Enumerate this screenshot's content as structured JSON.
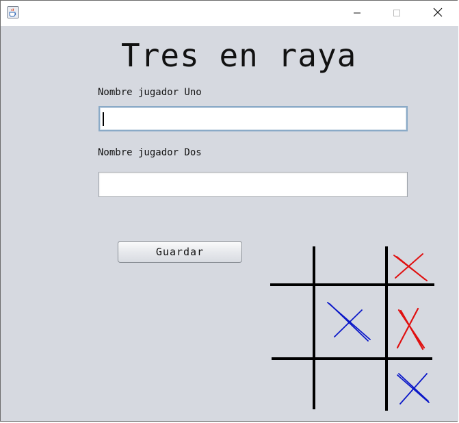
{
  "window": {
    "title": "",
    "icon": "java-cup-icon"
  },
  "titlebar_buttons": {
    "minimize_icon": "minimize-icon",
    "maximize_icon": "maximize-icon",
    "close_icon": "close-icon"
  },
  "app": {
    "title": "Tres en raya",
    "player_one_label": "Nombre jugador Uno",
    "player_one_value": "",
    "player_two_label": "Nombre jugador Dos",
    "player_two_value": "",
    "save_label": "Guardar"
  },
  "board_art": {
    "description_icon": "tic-tac-toe-board-image",
    "marks": [
      {
        "cell": "top-right",
        "color": "#e01010"
      },
      {
        "cell": "middle-center",
        "color": "#0a17c8"
      },
      {
        "cell": "middle-right",
        "color": "#e01010"
      },
      {
        "cell": "bottom-right",
        "color": "#0a17c8"
      }
    ]
  }
}
